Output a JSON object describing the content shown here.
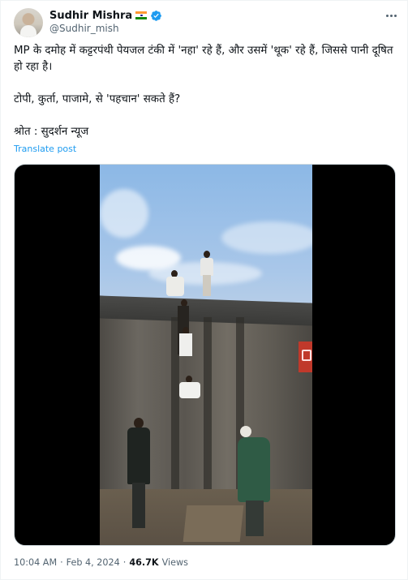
{
  "author": {
    "display_name": "Sudhir Mishra",
    "handle": "@Sudhir_mish",
    "flag_icon": "india-flag-icon",
    "verified_icon": "verified-badge-icon",
    "verified_color": "#1d9bf0"
  },
  "post": {
    "line1": "MP के दमोह में कट्टरपंथी पेयजल टंकी में 'नहा' रहे हैं, और उसमें 'थूक' रहे हैं, जिससे पानी दूषित हो रहा है।",
    "line2": "टोपी, कुर्ता, पाजामे, से 'पहचान' सकते हैं?",
    "line3": "श्रोत : सुदर्शन न्यूज",
    "translate_label": "Translate post"
  },
  "media": {
    "type": "video"
  },
  "meta": {
    "time": "10:04 AM",
    "separator": "·",
    "date": "Feb 4, 2024",
    "views_count": "46.7K",
    "views_label": "Views"
  },
  "colors": {
    "text_primary": "#0f1419",
    "text_secondary": "#536471",
    "link": "#1d9bf0"
  }
}
